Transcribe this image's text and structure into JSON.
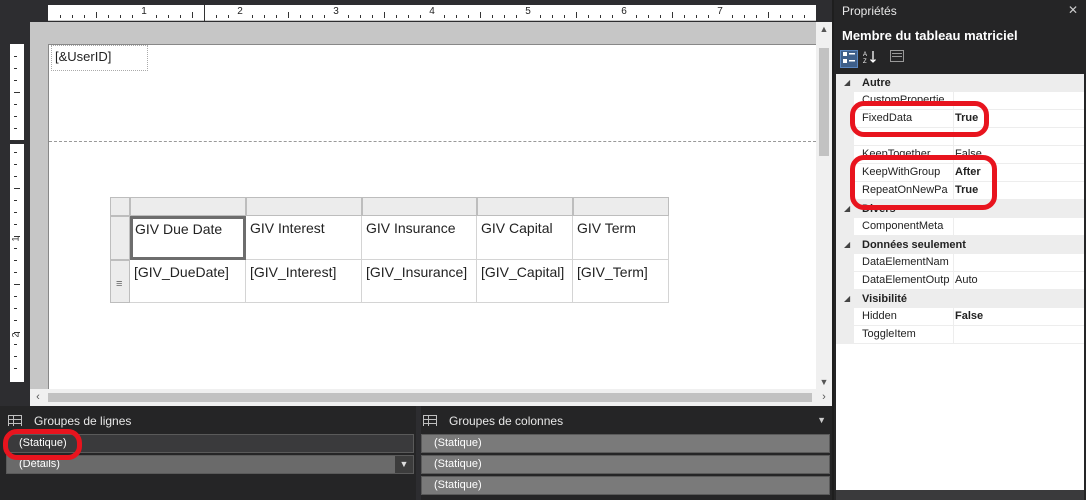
{
  "designer": {
    "ruler_numbers": [
      "1",
      "2",
      "3",
      "4",
      "5",
      "6",
      "7"
    ],
    "vruler_numbers": [
      "1",
      "2"
    ],
    "userid_expr": "[&UserID]",
    "table": {
      "headers": [
        "GIV Due Date",
        "GIV Interest",
        "GIV Insurance",
        "GIV Capital",
        "GIV Term"
      ],
      "details": [
        "[GIV_DueDate]",
        "[GIV_Interest]",
        "[GIV_Insurance]",
        "[GIV_Capital]",
        "[GIV_Term]"
      ],
      "row_glyph": "≡"
    }
  },
  "grouping": {
    "row_groups_label": "Groupes de lignes",
    "column_groups_label": "Groupes de colonnes",
    "row_groups": [
      "(Statique)",
      "(Détails)"
    ],
    "column_groups": [
      "(Statique)",
      "(Statique)",
      "(Statique)"
    ]
  },
  "properties": {
    "title": "Propriétés",
    "object": "Membre du tableau matriciel",
    "categories": {
      "autre": "Autre",
      "divers": "Divers",
      "donnees": "Données seulement",
      "visibilite": "Visibilité"
    },
    "rows": {
      "custom": {
        "name": "CustomPropertie",
        "value": ""
      },
      "fixeddata": {
        "name": "FixedData",
        "value": "True"
      },
      "keeptogether": {
        "name": "KeepTogether",
        "value": "False"
      },
      "keepwithgroup": {
        "name": "KeepWithGroup",
        "value": "After"
      },
      "repeatonnewpage": {
        "name": "RepeatOnNewPa",
        "value": "True"
      },
      "componentmeta": {
        "name": "ComponentMeta",
        "value": ""
      },
      "dataelementname": {
        "name": "DataElementNam",
        "value": ""
      },
      "dataelementoutput": {
        "name": "DataElementOutp",
        "value": "Auto"
      },
      "hidden": {
        "name": "Hidden",
        "value": "False"
      },
      "toggleitem": {
        "name": "ToggleItem",
        "value": ""
      }
    }
  },
  "colors": {
    "highlight": "#e8141e",
    "dark_bg": "#252526"
  }
}
